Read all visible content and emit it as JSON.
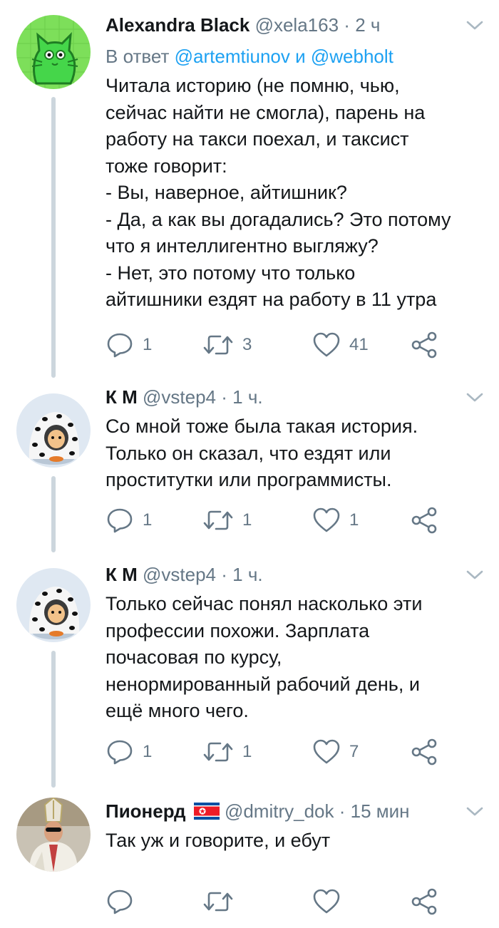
{
  "tweets": [
    {
      "name": "Alexandra Black",
      "handle": "@xela163",
      "time": "2 ч",
      "reply_prefix": "В ответ",
      "reply_user1": "@artemtiunov",
      "reply_and": "и",
      "reply_user2": "@webholt",
      "text": "Читала историю (не помню, чью,\nсейчас найти не смогла), парень на\nработу на такси поехал, и таксист\nтоже говорит:\n- Вы, наверное, айтишник?\n- Да, а как вы догадались? Это потому\nчто я интеллигентно выгляжу?\n- Нет, это потому что только\nайтишники ездят на работу в 11 утра",
      "replies": "1",
      "retweets": "3",
      "likes": "41"
    },
    {
      "name": "К М",
      "handle": "@vstep4",
      "time": "1 ч.",
      "text": "Со мной тоже была такая история.\nТолько он сказал, что ездят или\nпроститутки или программисты.",
      "replies": "1",
      "retweets": "1",
      "likes": "1"
    },
    {
      "name": "К М",
      "handle": "@vstep4",
      "time": "1 ч.",
      "text": "Только сейчас понял насколько эти\nпрофессии похожи. Зарплата\nпочасовая по курсу,\nненормированный рабочий день, и\nещё много чего.",
      "replies": "1",
      "retweets": "1",
      "likes": "7"
    },
    {
      "name": "Пионерд",
      "handle": "@dmitry_dok",
      "time": "15 мин",
      "text": "Так уж и говорите, и ебут",
      "replies": "",
      "retweets": "",
      "likes": ""
    }
  ],
  "icons": {
    "reply": "reply-icon",
    "retweet": "retweet-icon",
    "like": "heart-icon",
    "share": "share-icon",
    "caret": "chevron-down-icon"
  },
  "colors": {
    "text": "#14171a",
    "secondary": "#657786",
    "link": "#1da1f2",
    "thread_line": "#ccd6dd",
    "icon": "#657786"
  }
}
